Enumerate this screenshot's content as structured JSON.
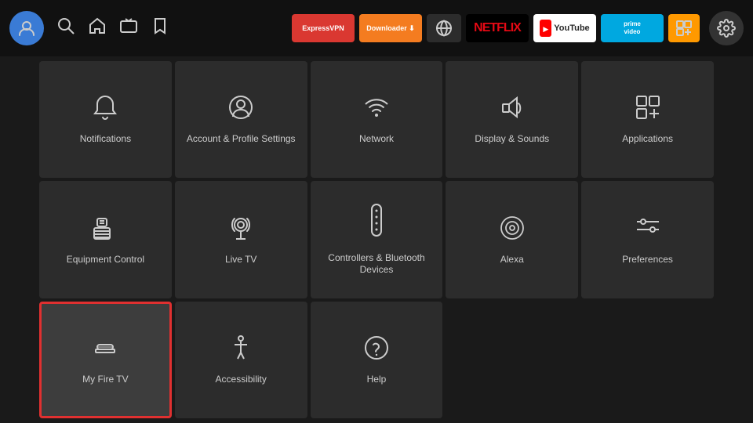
{
  "topNav": {
    "navIcons": [
      "search",
      "home",
      "tv",
      "bookmark"
    ],
    "apps": [
      {
        "name": "ExpressVPN",
        "label": "ExpressVPN",
        "type": "expressvpn"
      },
      {
        "name": "Downloader",
        "label": "Downloader ↓",
        "type": "downloader"
      },
      {
        "name": "Generic App",
        "label": "🌐",
        "type": "generic"
      },
      {
        "name": "Netflix",
        "label": "NETFLIX",
        "type": "netflix"
      },
      {
        "name": "YouTube",
        "label": "YouTube",
        "type": "youtube"
      },
      {
        "name": "Prime Video",
        "label": "prime video",
        "type": "prime"
      },
      {
        "name": "Squares",
        "label": "⊞",
        "type": "squares"
      }
    ],
    "settingsLabel": "⚙"
  },
  "grid": {
    "items": [
      {
        "id": "notifications",
        "label": "Notifications",
        "icon": "bell",
        "selected": false
      },
      {
        "id": "account-profile",
        "label": "Account & Profile Settings",
        "icon": "person-circle",
        "selected": false
      },
      {
        "id": "network",
        "label": "Network",
        "icon": "wifi",
        "selected": false
      },
      {
        "id": "display-sounds",
        "label": "Display & Sounds",
        "icon": "speaker",
        "selected": false
      },
      {
        "id": "applications",
        "label": "Applications",
        "icon": "apps",
        "selected": false
      },
      {
        "id": "equipment-control",
        "label": "Equipment Control",
        "icon": "tv-remote",
        "selected": false
      },
      {
        "id": "live-tv",
        "label": "Live TV",
        "icon": "antenna",
        "selected": false
      },
      {
        "id": "controllers-bluetooth",
        "label": "Controllers & Bluetooth Devices",
        "icon": "controller",
        "selected": false
      },
      {
        "id": "alexa",
        "label": "Alexa",
        "icon": "alexa",
        "selected": false
      },
      {
        "id": "preferences",
        "label": "Preferences",
        "icon": "sliders",
        "selected": false
      },
      {
        "id": "my-fire-tv",
        "label": "My Fire TV",
        "icon": "fire-remote",
        "selected": true
      },
      {
        "id": "accessibility",
        "label": "Accessibility",
        "icon": "accessibility",
        "selected": false
      },
      {
        "id": "help",
        "label": "Help",
        "icon": "help",
        "selected": false
      }
    ]
  }
}
